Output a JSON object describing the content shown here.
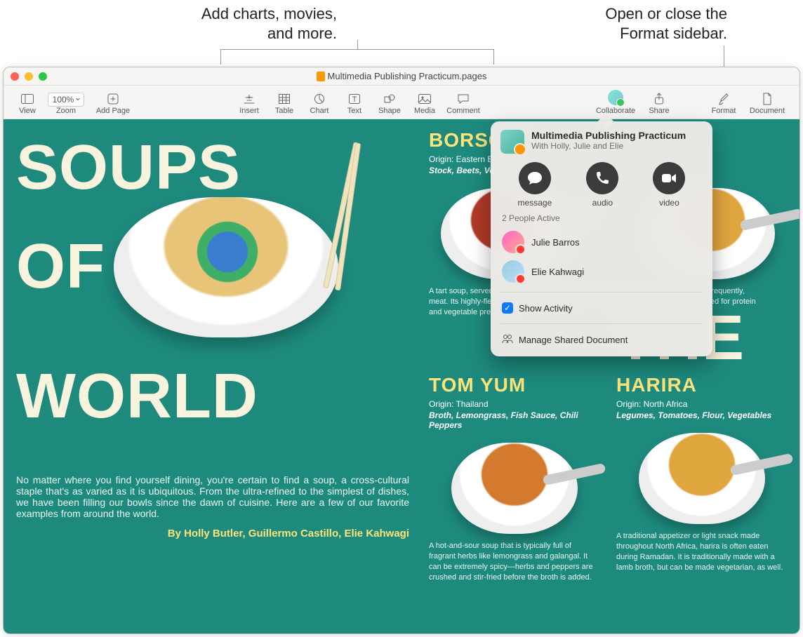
{
  "callouts": {
    "insert_group": "Add charts, movies,\nand more.",
    "format_sidebar": "Open or close the\nFormat sidebar."
  },
  "window": {
    "title": "Multimedia Publishing Practicum.pages"
  },
  "toolbar": {
    "view": "View",
    "zoom": "Zoom",
    "zoom_value": "100%",
    "add_page": "Add Page",
    "insert": "Insert",
    "table": "Table",
    "chart": "Chart",
    "text": "Text",
    "shape": "Shape",
    "media": "Media",
    "comment": "Comment",
    "collaborate": "Collaborate",
    "share": "Share",
    "format": "Format",
    "document": "Document"
  },
  "document": {
    "title_l1": "SOUPS",
    "title_l2a": "OF",
    "title_l2b": "THE",
    "title_l3": "WORLD",
    "intro": "No matter where you find yourself dining, you're certain to find a soup, a cross-cultural staple that's as varied as it is ubiquitous. From the ultra-refined to the simplest of dishes, we have been filling our bowls since the dawn of cuisine. Here are a few of our favorite examples from around the world.",
    "byline": "By Holly Butler, Guillermo Castillo, Elie Kahwagi",
    "cards": [
      {
        "name": "BORSCHT",
        "origin": "Origin: Eastern Europe",
        "ingredients": "Stock, Beets, Vegetables",
        "desc": "A tart soup, served hot or cold, whose distinctive red color comes from beets and, frequently, meat. Its highly-flexible, the soup can be light or hearty, and there are versions suited for protein and vegetable preparation."
      },
      {
        "name": "TOM YUM",
        "origin": "Origin: Thailand",
        "ingredients": "Broth, Lemongrass, Fish Sauce, Chili Peppers",
        "desc": "A hot-and-sour soup that is typically full of fragrant herbs like lemongrass and galangal. It can be extremely spicy—herbs and peppers are crushed and stir-fried before the broth is added."
      },
      {
        "name": "HARIRA",
        "origin": "Origin: North Africa",
        "ingredients": "Legumes, Tomatoes, Flour, Vegetables",
        "desc": "A traditional appetizer or light snack made throughout North Africa, harira is often eaten during Ramadan. It is traditionally made with a lamb broth, but can be made vegetarian, as well."
      }
    ]
  },
  "collab_popup": {
    "title": "Multimedia Publishing Practicum",
    "subtitle": "With Holly, Julie and Elie",
    "message": "message",
    "audio": "audio",
    "video": "video",
    "active_header": "2 People Active",
    "people": [
      "Julie Barros",
      "Elie Kahwagi"
    ],
    "show_activity": "Show Activity",
    "manage": "Manage Shared Document"
  }
}
